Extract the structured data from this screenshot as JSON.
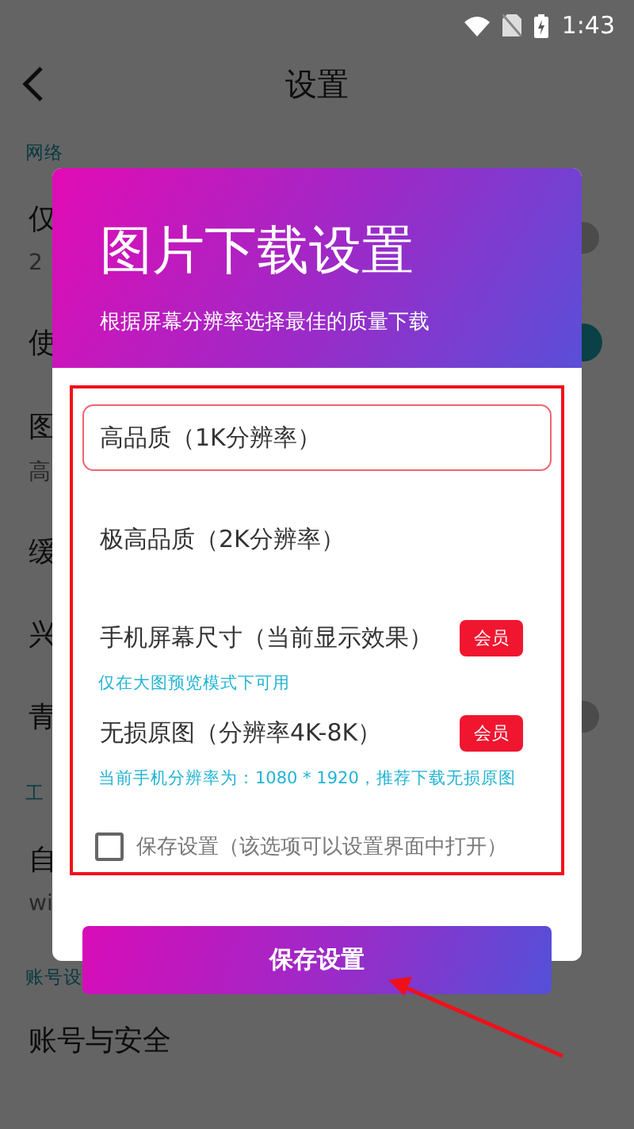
{
  "status_bar": {
    "time": "1:43"
  },
  "header": {
    "title": "设置"
  },
  "settings": [
    {
      "kind": "section",
      "label": "网络"
    },
    {
      "kind": "toggle",
      "title": "仅",
      "subtitle": "2",
      "on": false
    },
    {
      "kind": "toggle",
      "title": "使",
      "on": true
    },
    {
      "kind": "row",
      "title": "图",
      "subtitle": "高"
    },
    {
      "kind": "row",
      "title": "缓"
    },
    {
      "kind": "row",
      "title": "兴"
    },
    {
      "kind": "toggle",
      "title": "青",
      "on": false
    },
    {
      "kind": "section",
      "label": "工"
    },
    {
      "kind": "row",
      "title": "自",
      "subtitle": "wi"
    },
    {
      "kind": "section",
      "label": "账号设"
    },
    {
      "kind": "row",
      "title": "账号与安全"
    }
  ],
  "dialog": {
    "title": "图片下载设置",
    "subtitle": "根据屏幕分辨率选择最佳的质量下载",
    "options": [
      {
        "label": "高品质（1K分辨率）",
        "selected": true
      },
      {
        "label": "极高品质（2K分辨率）",
        "selected": false
      },
      {
        "label": "手机屏幕尺寸（当前显示效果）",
        "selected": false,
        "badge": "会员",
        "hint": "仅在大图预览模式下可用"
      },
      {
        "label": "无损原图（分辨率4K-8K）",
        "selected": false,
        "badge": "会员",
        "hint": "当前手机分辨率为：1080 * 1920，推荐下载无损原图"
      }
    ],
    "remember": {
      "label": "保存设置（该选项可以设置界面中打开）",
      "checked": false
    },
    "button": "保存设置"
  }
}
